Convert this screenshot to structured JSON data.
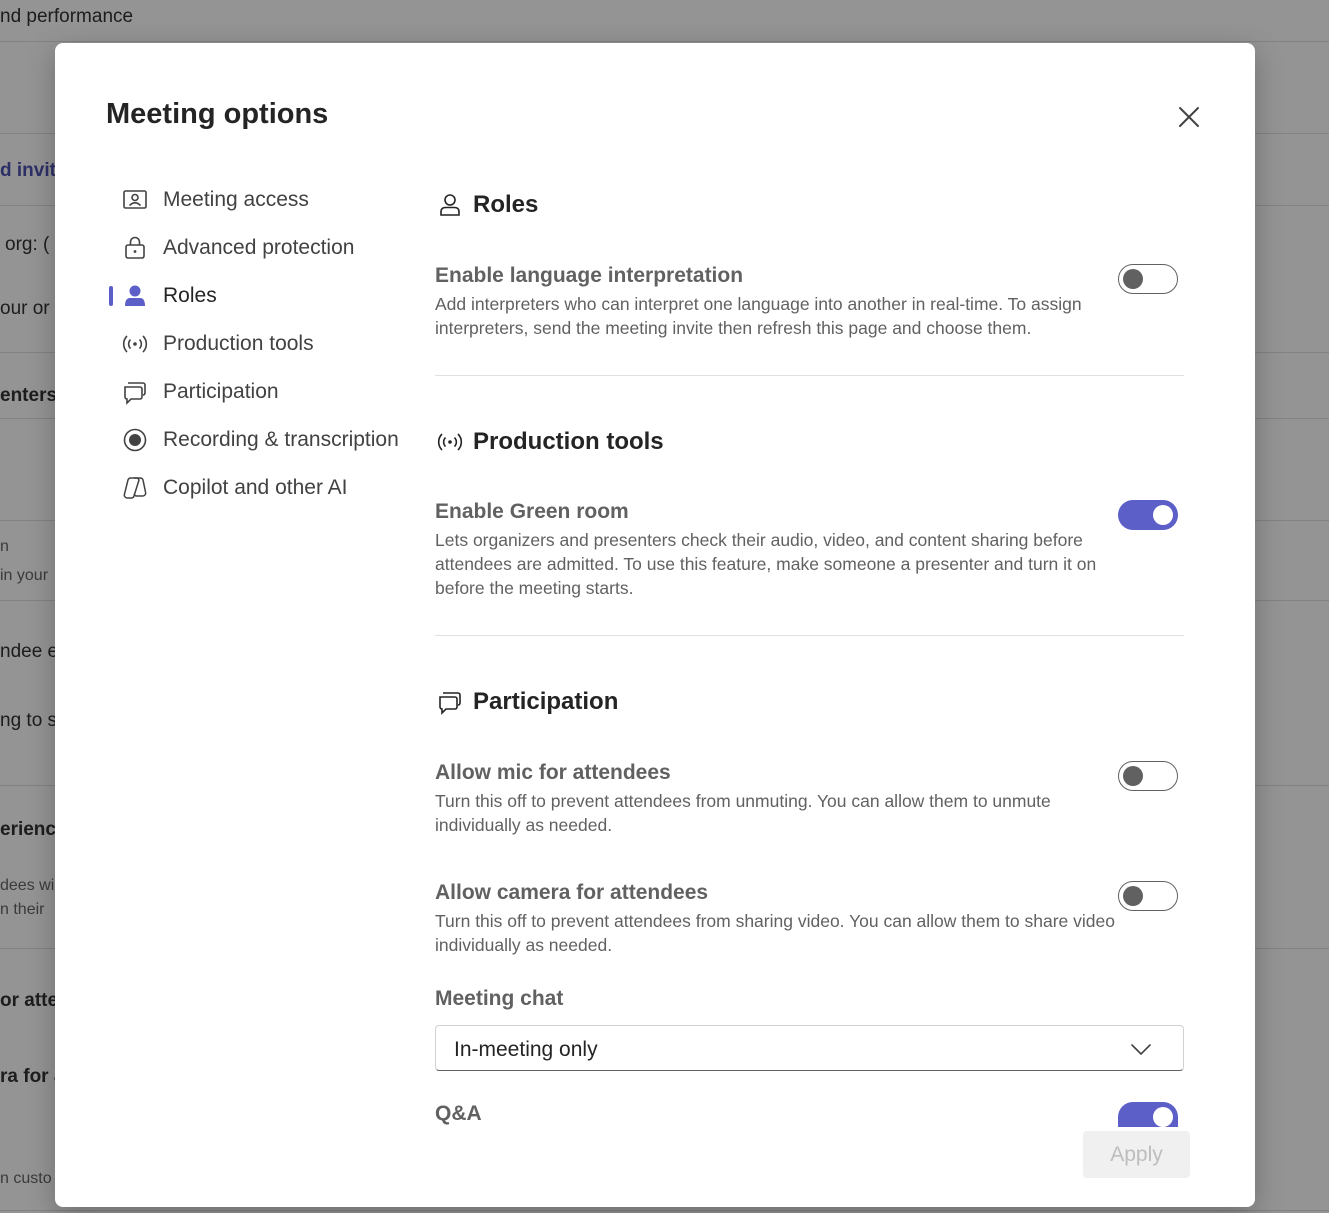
{
  "background": {
    "fragments": [
      {
        "name": "bg-heading",
        "text": "nd performance"
      },
      {
        "name": "bg-invite-link",
        "text": "d invit"
      },
      {
        "name": "bg-org-label",
        "text": "org: ("
      },
      {
        "name": "bg-your-org",
        "text": "our or"
      },
      {
        "name": "bg-presenters",
        "text": "enters"
      },
      {
        "name": "bg-n",
        "text": "n"
      },
      {
        "name": "bg-in-your",
        "text": "in your"
      },
      {
        "name": "bg-attendee",
        "text": "ndee e"
      },
      {
        "name": "bg-ng-to",
        "text": "ng to s"
      },
      {
        "name": "bg-experience",
        "text": "erience"
      },
      {
        "name": "bg-dees-wi",
        "text": "dees wi"
      },
      {
        "name": "bg-n-their",
        "text": "n their"
      },
      {
        "name": "bg-or-atte",
        "text": "or atte"
      },
      {
        "name": "bg-ra-for",
        "text": "ra for a"
      },
      {
        "name": "bg-custo",
        "text": "n custo"
      }
    ]
  },
  "dialog": {
    "title": "Meeting options",
    "apply_label": "Apply"
  },
  "nav": {
    "items": [
      {
        "label": "Meeting access",
        "icon": "person-card-icon"
      },
      {
        "label": "Advanced protection",
        "icon": "lock-icon"
      },
      {
        "label": "Roles",
        "icon": "person-icon",
        "active": true
      },
      {
        "label": "Production tools",
        "icon": "broadcast-icon"
      },
      {
        "label": "Participation",
        "icon": "chat-bubbles-icon"
      },
      {
        "label": "Recording & transcription",
        "icon": "record-icon"
      },
      {
        "label": "Copilot and other AI",
        "icon": "copilot-icon"
      }
    ]
  },
  "sections": {
    "roles": {
      "title": "Roles",
      "language": {
        "title": "Enable language interpretation",
        "desc": "Add interpreters who can interpret one language into another in real-time. To assign interpreters, send the meeting invite then refresh this page and choose them.",
        "enabled": false
      }
    },
    "production": {
      "title": "Production tools",
      "green_room": {
        "title": "Enable Green room",
        "desc": "Lets organizers and presenters check their audio, video, and content sharing before attendees are admitted. To use this feature, make someone a presenter and turn it on before the meeting starts.",
        "enabled": true
      }
    },
    "participation": {
      "title": "Participation",
      "mic": {
        "title": "Allow mic for attendees",
        "desc": "Turn this off to prevent attendees from unmuting. You can allow them to unmute individually as needed.",
        "enabled": false
      },
      "camera": {
        "title": "Allow camera for attendees",
        "desc": "Turn this off to prevent attendees from sharing video. You can allow them to share video individually as needed.",
        "enabled": false
      },
      "chat": {
        "label": "Meeting chat",
        "value": "In-meeting only"
      },
      "qa": {
        "title": "Q&A",
        "enabled": true
      }
    }
  },
  "colors": {
    "accent": "#5b5fc7",
    "text_primary": "#242424",
    "text_secondary": "#616161"
  }
}
